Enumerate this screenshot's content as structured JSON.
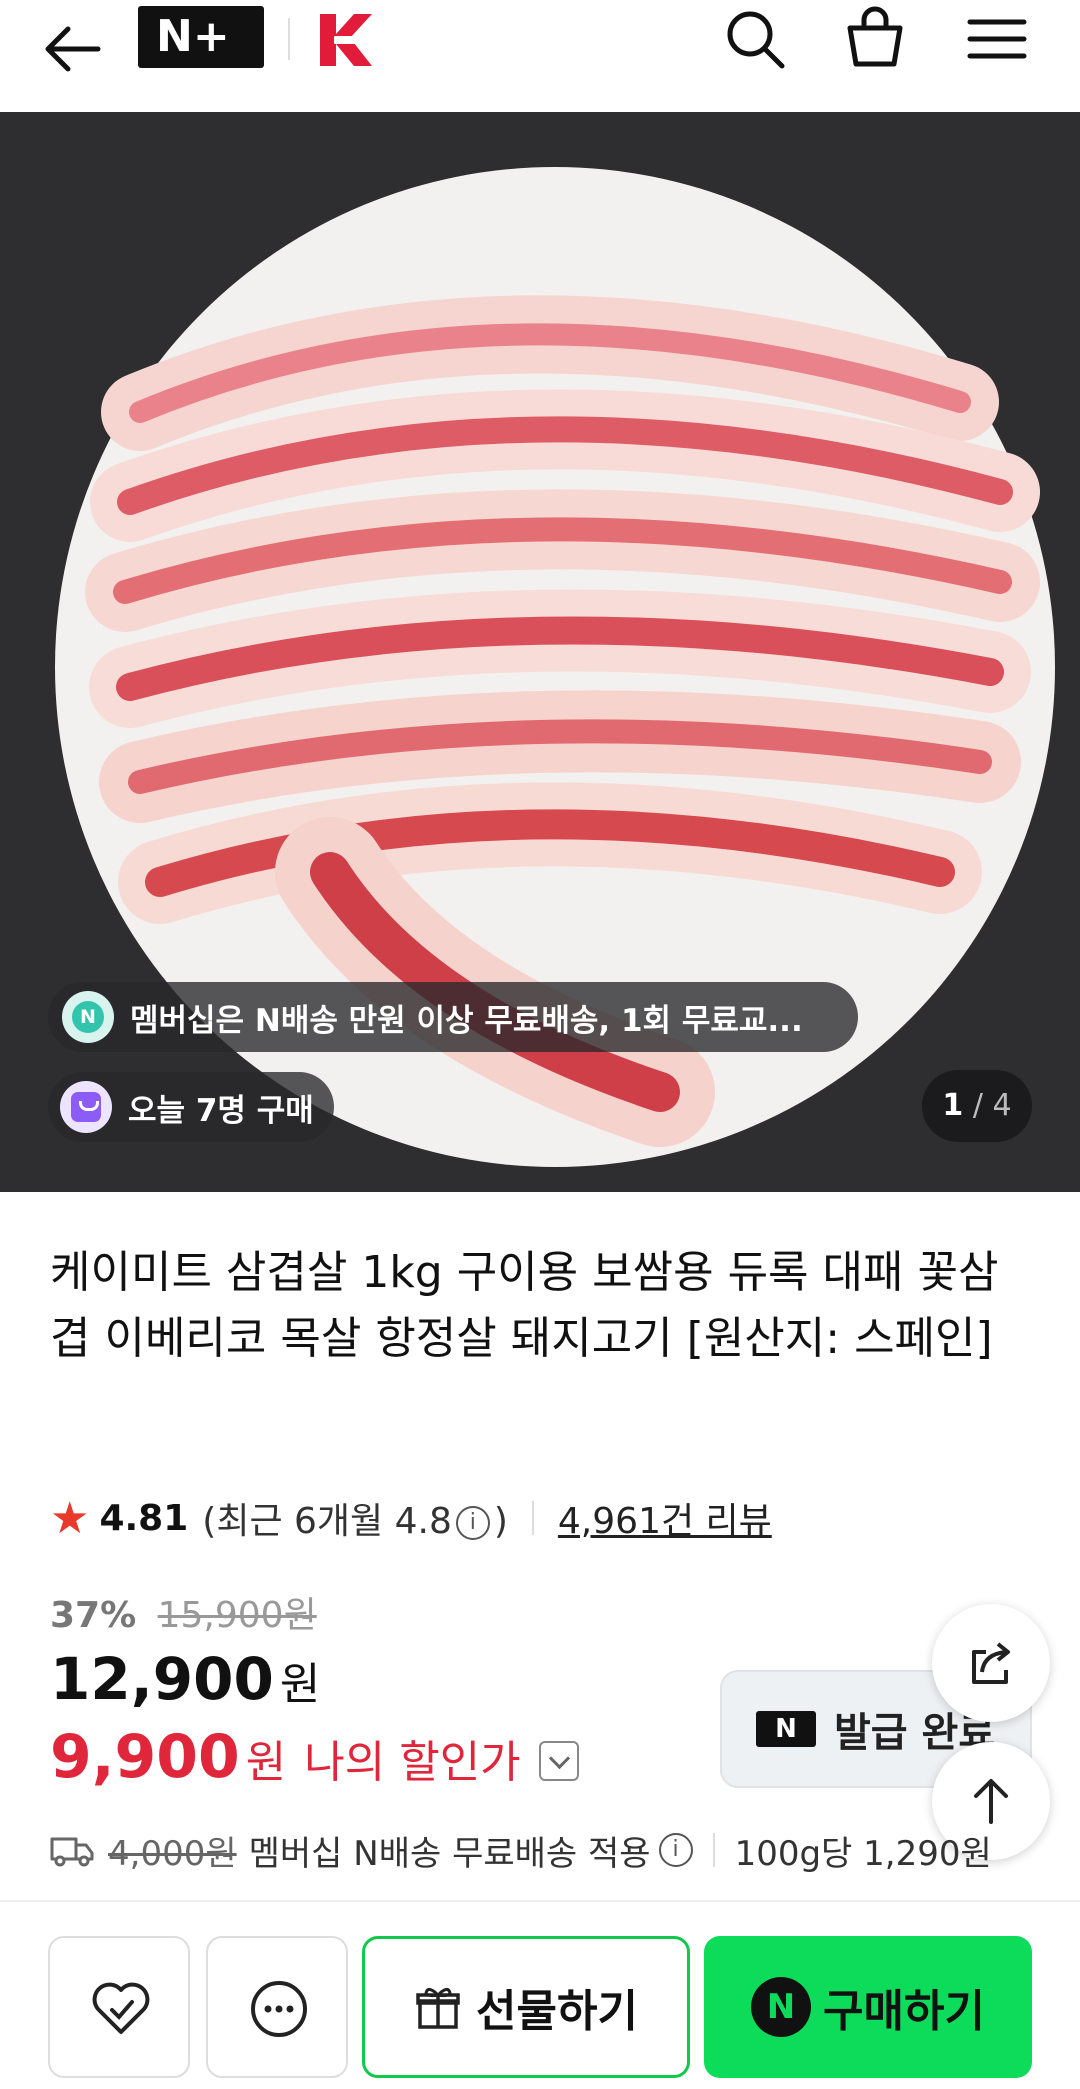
{
  "header": {
    "brand_nplus": "N+",
    "icons": [
      "back-arrow-icon",
      "nplus-logo",
      "kmeat-logo",
      "search-icon",
      "cart-icon",
      "menu-icon"
    ]
  },
  "hero": {
    "promo_text": "멤버십은 N배송 만원 이상 무료배송, 1회 무료교...",
    "promo_icon_letter": "N",
    "today_text": "오늘 7명 구매",
    "page_current": "1",
    "page_separator": "/",
    "page_total": "4"
  },
  "product": {
    "title": "케이미트 삼겹살 1kg 구이용 보쌈용 듀록 대패 꽃삼겹 이베리코 목살 항정살 돼지고기 [원산지: 스페인]",
    "rating": {
      "score": "4.81",
      "recent_prefix": "(최근 6개월 4.8",
      "info": "i",
      "recent_suffix": ")",
      "review_count": "4,961건 리뷰"
    },
    "price": {
      "discount_pct": "37%",
      "original": "15,900원",
      "sale": "12,900",
      "sale_unit": "원",
      "my_price": "9,900",
      "my_price_unit": "원",
      "my_price_label": "나의 할인가"
    },
    "coupon": {
      "logo": "N",
      "label": "발급 완료"
    },
    "delivery": {
      "fee": "4,000원",
      "text": "멤버십 N배송 무료배송 적용",
      "info": "i",
      "unit_price": "100g당 1,290원"
    }
  },
  "bottom_bar": {
    "gift_label": "선물하기",
    "buy_logo": "N",
    "buy_label": "구매하기"
  },
  "colors": {
    "accent_green": "#0ddc5a",
    "price_red": "#e0263a",
    "star_red": "#e8392a"
  }
}
